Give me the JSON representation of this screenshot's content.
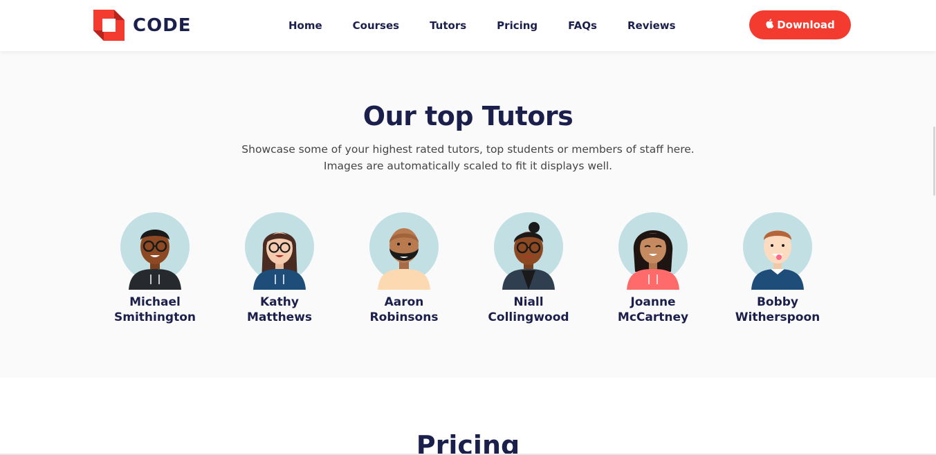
{
  "brand": {
    "name": "CODE",
    "color": "#f43b2f",
    "text_color": "#1b1f4b"
  },
  "nav": {
    "items": [
      "Home",
      "Courses",
      "Tutors",
      "Pricing",
      "FAQs",
      "Reviews"
    ]
  },
  "download": {
    "label": "Download",
    "icon": "apple-icon"
  },
  "tutors_section": {
    "title": "Our top Tutors",
    "subtitle_line1": "Showcase some of your highest rated tutors, top students or members of staff here.",
    "subtitle_line2": "Images are automatically scaled to fit it displays well.",
    "tutors": [
      {
        "first": "Michael",
        "last": "Smithington"
      },
      {
        "first": "Kathy",
        "last": "Matthews"
      },
      {
        "first": "Aaron",
        "last": "Robinsons"
      },
      {
        "first": "Niall",
        "last": "Collingwood"
      },
      {
        "first": "Joanne",
        "last": "McCartney"
      },
      {
        "first": "Bobby",
        "last": "Witherspoon"
      }
    ]
  },
  "pricing": {
    "title": "Pricing"
  }
}
